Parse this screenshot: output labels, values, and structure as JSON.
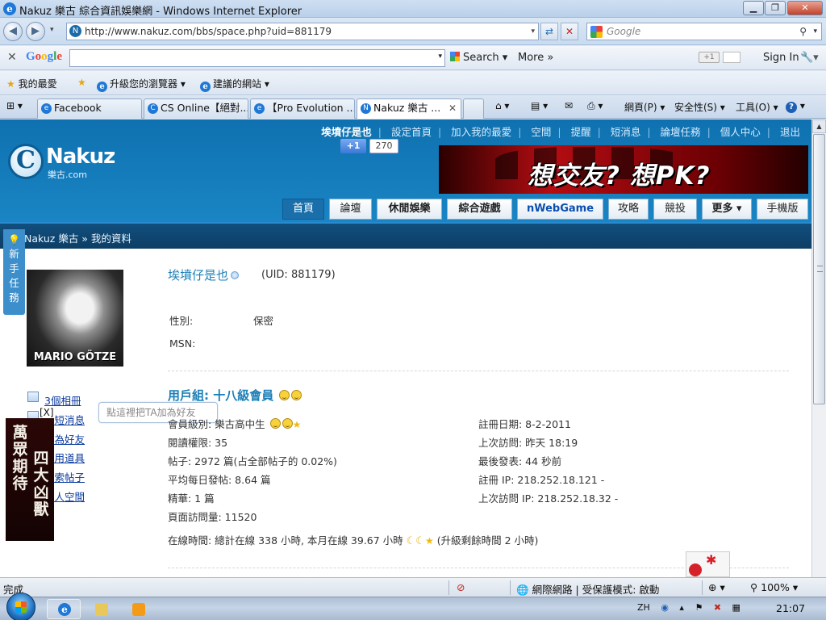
{
  "window": {
    "title": "Nakuz 樂古 綜合資訊娛樂網 - Windows Internet Explorer"
  },
  "address": {
    "url": "http://www.nakuz.com/bbs/space.php?uid=881179",
    "search_placeholder": "Google"
  },
  "google_toolbar": {
    "brand": "Google",
    "search_label": "Search",
    "more_label": "More »",
    "plus1": "+1",
    "signin": "Sign In"
  },
  "favorites": {
    "favorites_label": "我的最愛",
    "upgrade_label": "升級您的瀏覽器",
    "suggested_label": "建議的網站"
  },
  "tabs": [
    {
      "label": "Facebook"
    },
    {
      "label": "CS Online【絕對..."
    },
    {
      "label": "【Pro Evolution ..."
    },
    {
      "label": "Nakuz 樂古 ..."
    }
  ],
  "commands": {
    "page": "網頁(P)",
    "safety": "安全性(S)",
    "tools": "工具(O)",
    "help": "?"
  },
  "site": {
    "topnav": [
      "設定首頁",
      "加入我的最愛",
      "空間",
      "提醒",
      "短消息",
      "論壇任務",
      "個人中心",
      "退出"
    ],
    "current_user": "埃墳仔是也",
    "gplus_label": "+1",
    "gplus_count": "270",
    "logo_name": "Nakuz",
    "logo_domain": "樂古.com",
    "banner_text": "想交友? 想PK?",
    "nav": [
      "首頁",
      "論壇",
      "休閒娛樂",
      "綜合遊戲",
      "nWebGame",
      "攻略",
      "競投",
      "更多 ▾",
      "手機版"
    ],
    "breadcrumb": "Nakuz 樂古 » 我的資料",
    "newbie_label": "新手任務"
  },
  "profile": {
    "avatar_caption": "MARIO GÖTZE",
    "username": "埃墳仔是也",
    "uid": "(UID: 881179)",
    "gender_label": "性別:",
    "gender_value": "保密",
    "msn_label": "MSN:",
    "group": "用戶組: 十八級會員",
    "side_links": [
      "3個相冊",
      "發短消息",
      "加為好友",
      "使用道具",
      "搜索帖子",
      "個人空間"
    ],
    "tooltip": "點這裡把TA加為好友",
    "tooltip_close": "[X]",
    "left_stats": [
      "會員級別: 樂古高中生",
      "閱讀權限: 35",
      "帖子: 2972 篇(占全部帖子的 0.02%)",
      "平均每日發帖: 8.64 篇",
      "精華: 1 篇",
      "頁面訪問量: 11520"
    ],
    "right_stats": [
      "註冊日期: 8-2-2011",
      "上次訪問: 昨天 18:19",
      "最後發表: 44 秒前",
      "註冊 IP: 218.252.18.121 -",
      "上次訪問 IP: 218.252.18.32 -"
    ],
    "online_time": "在線時間: 總計在線 338 小時, 本月在線 39.67 小時",
    "online_upgrade": "(升級剩餘時間 2 小時)"
  },
  "ad": {
    "col1": "萬眾期待",
    "col2": "四大凶獸"
  },
  "status": {
    "done": "完成",
    "zone": "網際網路 | 受保護模式: 啟動",
    "zoom": "100%"
  },
  "taskbar": {
    "lang": "ZH",
    "time": "21:07"
  }
}
